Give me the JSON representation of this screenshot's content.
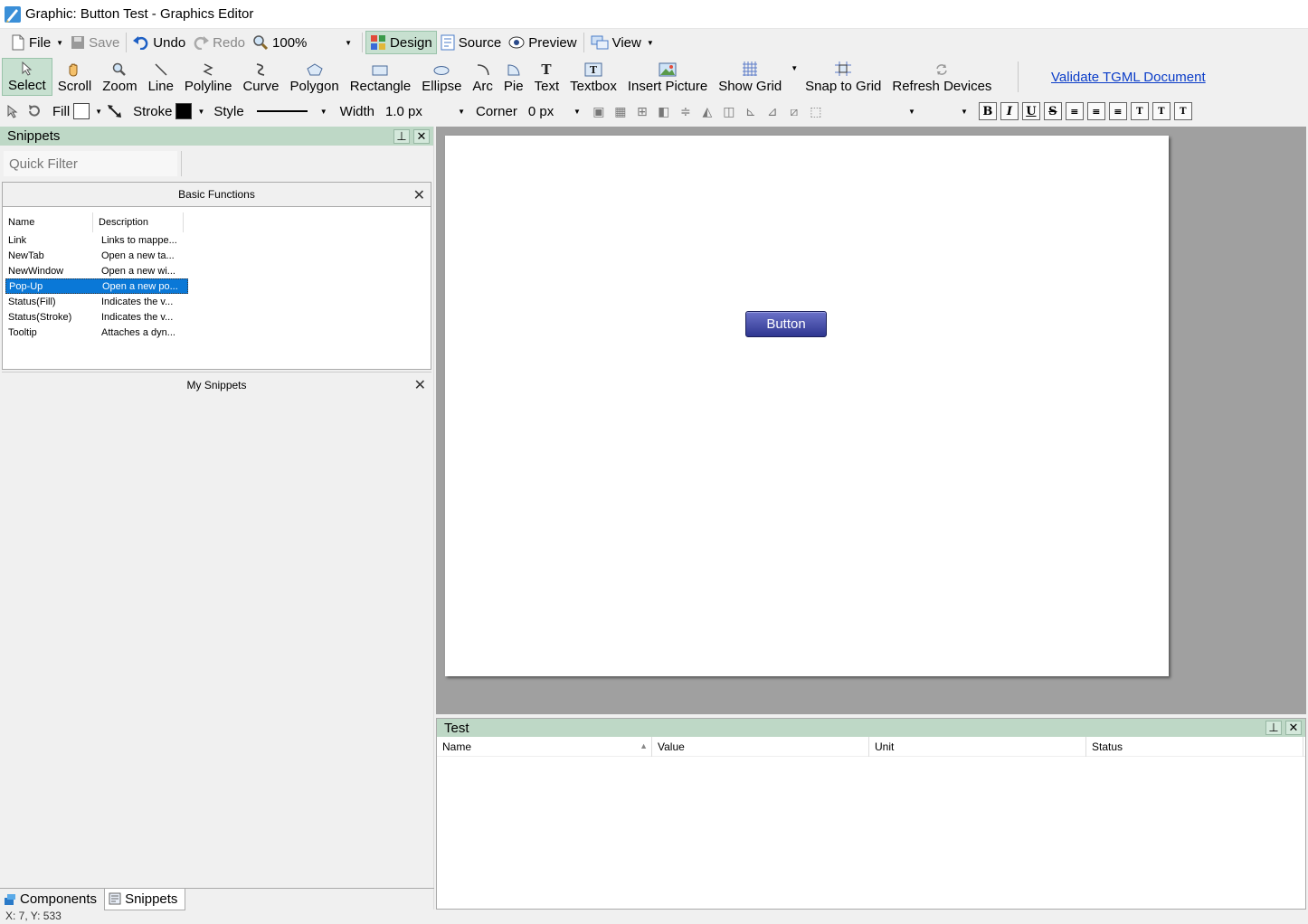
{
  "window": {
    "title": "Graphic: Button Test - Graphics Editor"
  },
  "toolbar": {
    "file": "File",
    "save": "Save",
    "undo": "Undo",
    "redo": "Redo",
    "zoom": "100%",
    "design": "Design",
    "source": "Source",
    "preview": "Preview",
    "view": "View"
  },
  "tools": {
    "select": "Select",
    "scroll": "Scroll",
    "zoom": "Zoom",
    "line": "Line",
    "polyline": "Polyline",
    "curve": "Curve",
    "polygon": "Polygon",
    "rectangle": "Rectangle",
    "ellipse": "Ellipse",
    "arc": "Arc",
    "pie": "Pie",
    "text": "Text",
    "textbox": "Textbox",
    "insert_picture": "Insert Picture",
    "show_grid": "Show Grid",
    "snap_to_grid": "Snap to Grid",
    "refresh_devices": "Refresh Devices",
    "validate": "Validate TGML Document"
  },
  "format": {
    "fill_label": "Fill",
    "fill_color": "#ffffff",
    "stroke_label": "Stroke",
    "stroke_color": "#000000",
    "style_label": "Style",
    "width_label": "Width",
    "width_value": "1.0 px",
    "corner_label": "Corner",
    "corner_value": "0 px",
    "text_buttons": [
      "B",
      "I",
      "U",
      "S"
    ]
  },
  "snippets": {
    "header": "Snippets",
    "filter_placeholder": "Quick Filter",
    "group_title": "Basic Functions",
    "col_name": "Name",
    "col_desc": "Description",
    "items": [
      {
        "name": "Link",
        "desc": "Links to mappe..."
      },
      {
        "name": "NewTab",
        "desc": "Open a new ta..."
      },
      {
        "name": "NewWindow",
        "desc": "Open a new wi..."
      },
      {
        "name": "Pop-Up",
        "desc": "Open a new po..."
      },
      {
        "name": "Status(Fill)",
        "desc": "Indicates the v..."
      },
      {
        "name": "Status(Stroke)",
        "desc": "Indicates the v..."
      },
      {
        "name": "Tooltip",
        "desc": "Attaches a dyn..."
      }
    ],
    "selected_index": 3,
    "my_snippets": "My Snippets"
  },
  "bottom_tabs": {
    "components": "Components",
    "snippets": "Snippets"
  },
  "canvas": {
    "button_label": "Button"
  },
  "test_panel": {
    "header": "Test",
    "cols": [
      "Name",
      "Value",
      "Unit",
      "Status"
    ]
  },
  "status": {
    "coords": "X: 7, Y: 533"
  }
}
